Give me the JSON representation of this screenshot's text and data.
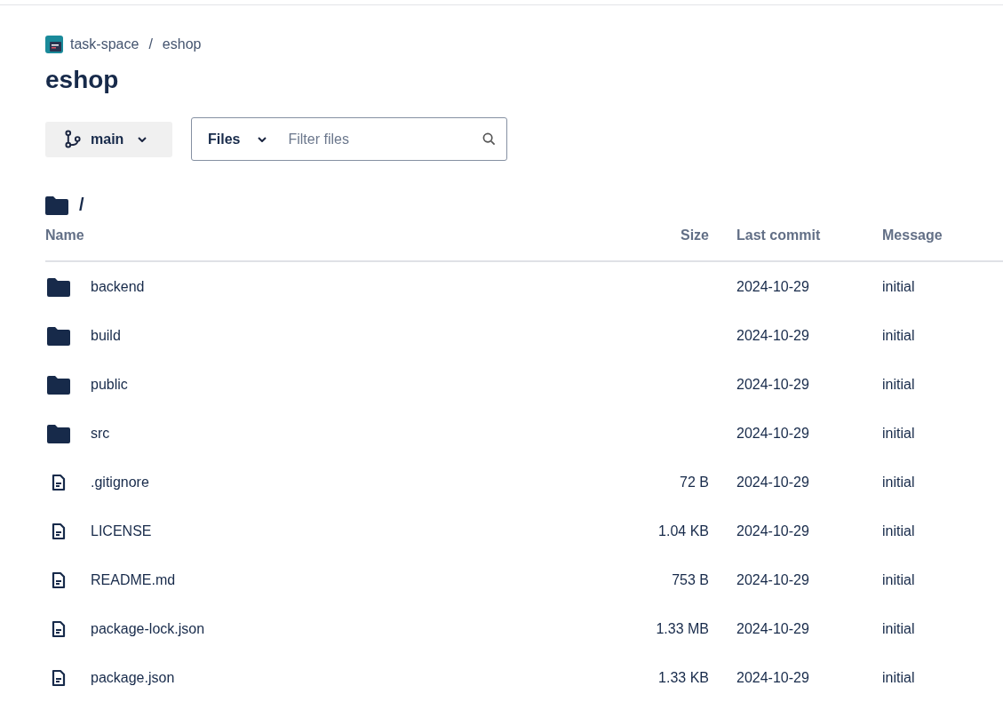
{
  "breadcrumb": {
    "workspace": "task-space",
    "separator": "/",
    "repo": "eshop"
  },
  "title": "eshop",
  "branch": {
    "label": "main"
  },
  "filter": {
    "scope": "Files",
    "placeholder": "Filter files"
  },
  "path": "/",
  "table": {
    "columns": [
      "Name",
      "Size",
      "Last commit",
      "Message"
    ],
    "rows": [
      {
        "kind": "folder",
        "name": "backend",
        "last_commit": "2024-10-29",
        "message": "initial"
      },
      {
        "kind": "folder",
        "name": "build",
        "last_commit": "2024-10-29",
        "message": "initial"
      },
      {
        "kind": "folder",
        "name": "public",
        "last_commit": "2024-10-29",
        "message": "initial"
      },
      {
        "kind": "folder",
        "name": "src",
        "last_commit": "2024-10-29",
        "message": "initial"
      },
      {
        "kind": "file",
        "name": ".gitignore",
        "size": "72 B",
        "last_commit": "2024-10-29",
        "message": "initial"
      },
      {
        "kind": "file",
        "name": "LICENSE",
        "size": "1.04 KB",
        "last_commit": "2024-10-29",
        "message": "initial"
      },
      {
        "kind": "file",
        "name": "README.md",
        "size": "753 B",
        "last_commit": "2024-10-29",
        "message": "initial"
      },
      {
        "kind": "file",
        "name": "package-lock.json",
        "size": "1.33 MB",
        "last_commit": "2024-10-29",
        "message": "initial"
      },
      {
        "kind": "file",
        "name": "package.json",
        "size": "1.33 KB",
        "last_commit": "2024-10-29",
        "message": "initial"
      }
    ]
  }
}
